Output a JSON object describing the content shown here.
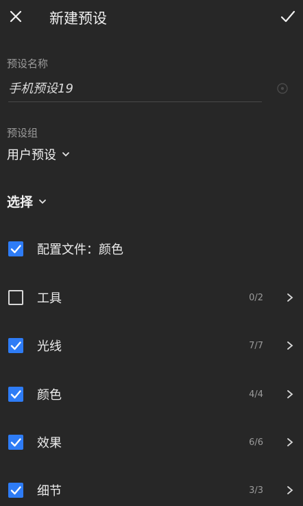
{
  "header": {
    "title": "新建预设"
  },
  "preset_name": {
    "label": "预设名称",
    "value": "手机预设19"
  },
  "preset_group": {
    "label": "预设组",
    "value": "用户预设"
  },
  "select": {
    "label": "选择"
  },
  "rows": [
    {
      "label": "配置文件：颜色",
      "checked": true,
      "count": "",
      "has_arrow": false
    },
    {
      "label": "工具",
      "checked": false,
      "count": "0/2",
      "has_arrow": true
    },
    {
      "label": "光线",
      "checked": true,
      "count": "7/7",
      "has_arrow": true
    },
    {
      "label": "颜色",
      "checked": true,
      "count": "4/4",
      "has_arrow": true
    },
    {
      "label": "效果",
      "checked": true,
      "count": "6/6",
      "has_arrow": true
    },
    {
      "label": "细节",
      "checked": true,
      "count": "3/3",
      "has_arrow": true
    }
  ],
  "colors": {
    "background": "#272727",
    "checkbox_checked": "#2e7cf6"
  }
}
